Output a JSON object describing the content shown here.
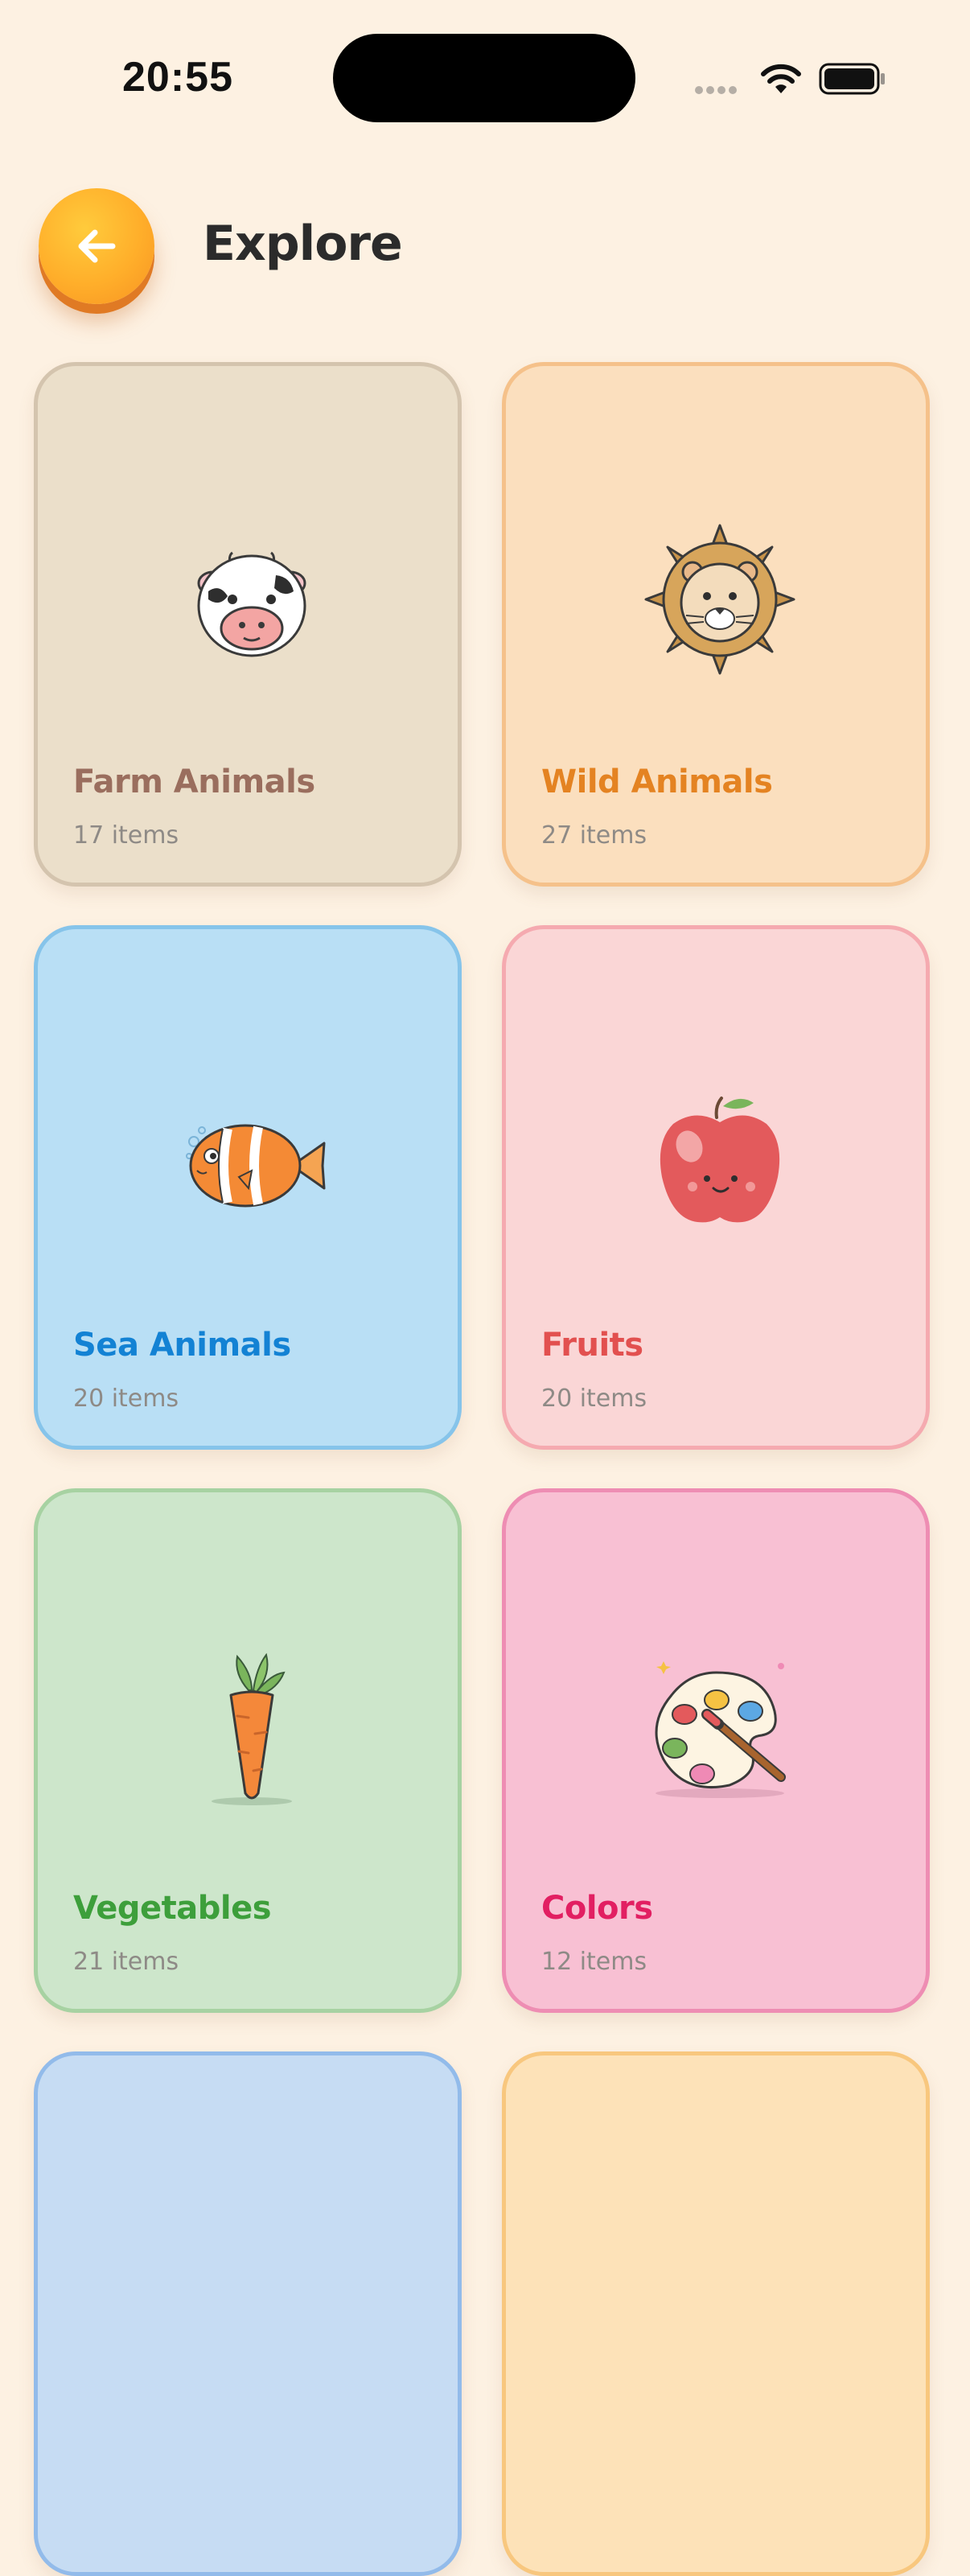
{
  "status_bar": {
    "time": "20:55"
  },
  "header": {
    "title": "Explore",
    "back_icon": "arrow-left-icon"
  },
  "colors": {
    "background": "#fdf1e2",
    "back_button": "#ffae2a"
  },
  "categories": [
    {
      "name": "Farm Animals",
      "count": "17 items",
      "icon": "cow-icon",
      "bg": "#ebdfca",
      "border": "#d4c4ae",
      "color": "#9a6e5e"
    },
    {
      "name": "Wild Animals",
      "count": "27 items",
      "icon": "lion-icon",
      "bg": "#fbdfbe",
      "border": "#f5c18a",
      "color": "#e48322"
    },
    {
      "name": "Sea Animals",
      "count": "20 items",
      "icon": "fish-icon",
      "bg": "#b9dff5",
      "border": "#86c4ea",
      "color": "#1382d4"
    },
    {
      "name": "Fruits",
      "count": "20 items",
      "icon": "apple-icon",
      "bg": "#fad6d6",
      "border": "#f5aab0",
      "color": "#e2504f"
    },
    {
      "name": "Vegetables",
      "count": "21 items",
      "icon": "carrot-icon",
      "bg": "#cde6cb",
      "border": "#a7d2a2",
      "color": "#3d9f3b"
    },
    {
      "name": "Colors",
      "count": "12 items",
      "icon": "palette-icon",
      "bg": "#f8c0d3",
      "border": "#ee8db3",
      "color": "#e21f62"
    }
  ],
  "partial_cards": [
    {
      "bg": "#c6dcf3",
      "border": "#92bbea"
    },
    {
      "bg": "#fde2b8",
      "border": "#f8c77e"
    }
  ]
}
